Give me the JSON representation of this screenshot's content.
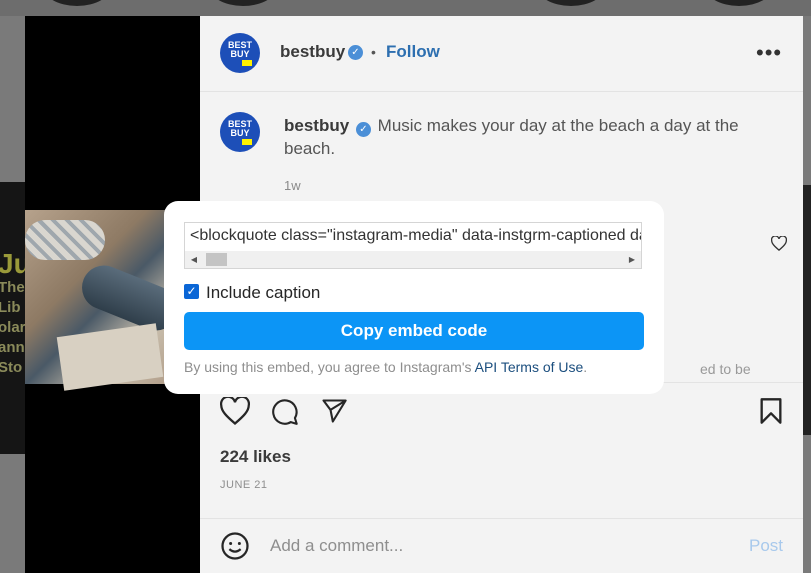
{
  "background": {
    "left_text_lines": [
      "The",
      "Lib",
      "olar",
      "ann",
      "Sto"
    ],
    "left_heading": "Ju"
  },
  "post": {
    "header": {
      "username": "bestbuy",
      "follow_label": "Follow",
      "separator": "•",
      "more_label": "•••"
    },
    "avatar_text": "BEST BUY",
    "caption": {
      "username": "bestbuy",
      "text": "Music makes your day at the beach a day at the beach.",
      "time_ago": "1w"
    },
    "likes": "224 likes",
    "date": "JUNE 21",
    "comment_placeholder": "Add a comment...",
    "post_label": "Post",
    "partial_comment_text": "ed to be"
  },
  "embed_dialog": {
    "code": "<blockquote class=\"instagram-media\" data-instgrm-captioned data-instgrm-permalink=",
    "include_caption_label": "Include caption",
    "include_caption_checked": true,
    "copy_button_label": "Copy embed code",
    "terms_prefix": "By using this embed, you agree to Instagram's",
    "terms_link": "API Terms of Use",
    "terms_suffix": "."
  },
  "colors": {
    "accent": "#0c95f6",
    "follow": "#2d6fb0",
    "link": "#1b4e7e",
    "verified": "#4b8fd7",
    "brand_blue": "#1d4fb8",
    "brand_yellow": "#fff200"
  },
  "icons": [
    "verified-badge-icon",
    "more-options-icon",
    "heart-icon",
    "comment-icon",
    "share-icon",
    "bookmark-icon",
    "emoji-icon",
    "scroll-left-icon",
    "scroll-right-icon",
    "checkbox-check-icon"
  ]
}
